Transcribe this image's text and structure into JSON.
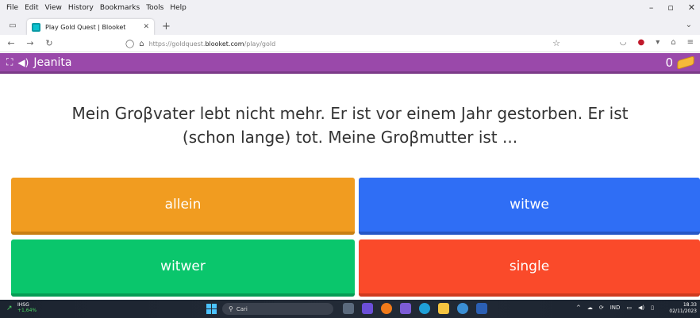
{
  "browser": {
    "menu": [
      "File",
      "Edit",
      "View",
      "History",
      "Bookmarks",
      "Tools",
      "Help"
    ],
    "tab": {
      "title": "Play Gold Quest | Blooket"
    },
    "url": {
      "prefix": "https://goldquest.",
      "domain": "blooket.com",
      "path": "/play/gold"
    }
  },
  "game": {
    "player_name": "Jeanita",
    "gold": "0",
    "question": "Mein Groβvater lebt nicht mehr. Er ist vor einem Jahr gestorben. Er ist (schon lange) tot. Meine Groβmutter ist ...",
    "answers": [
      "allein",
      "witwe",
      "witwer",
      "single"
    ],
    "colors": {
      "header": "#9a49aa",
      "answer_1": "#f19c20",
      "answer_2": "#2f6ef5",
      "answer_3": "#0ac66c",
      "answer_4": "#fa4a2a"
    }
  },
  "taskbar": {
    "stock_name": "IHSG",
    "stock_change": "+1,64%",
    "search_placeholder": "Cari",
    "language": "IND",
    "time": "18.33",
    "date": "02/11/2023"
  }
}
